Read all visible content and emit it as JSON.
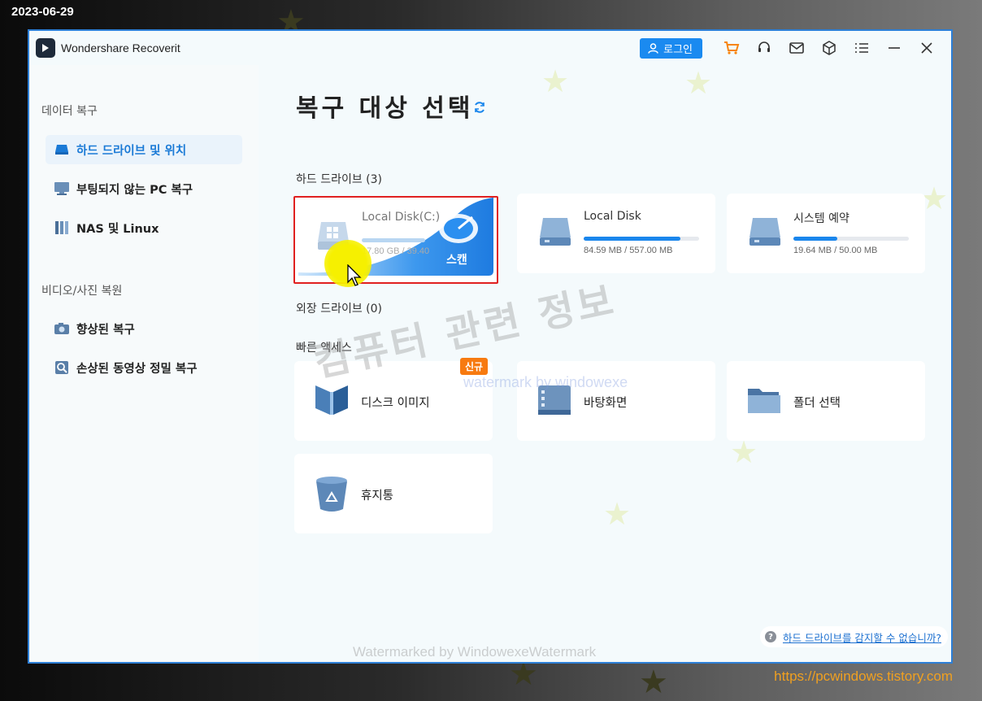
{
  "stamp": {
    "date": "2023-06-29",
    "url": "https://pcwindows.tistory.com"
  },
  "app": {
    "title": "Wondershare Recoverit",
    "login_label": "로그인",
    "toolbar_icons": [
      "cart-icon",
      "headset-icon",
      "mail-icon",
      "cube-icon",
      "menu-icon",
      "minimize-icon",
      "close-icon"
    ]
  },
  "sidebar": {
    "data_heading": "데이터 복구",
    "media_heading": "비디오/사진 복원",
    "items": [
      {
        "label": "하드 드라이브 및 위치",
        "icon": "hard-drive-icon",
        "active": true
      },
      {
        "label": "부팅되지 않는 PC 복구",
        "icon": "monitor-icon",
        "active": false
      },
      {
        "label": "NAS 및 Linux",
        "icon": "nas-icon",
        "active": false
      },
      {
        "label": "향상된 복구",
        "icon": "camera-icon",
        "active": false
      },
      {
        "label": "손상된 동영상 정밀 복구",
        "icon": "video-repair-icon",
        "active": false
      }
    ]
  },
  "main": {
    "title": "복구 대상 선택",
    "hard_drives_label": "하드 드라이브 (3)",
    "external_label": "외장 드라이브 (0)",
    "quick_access_label": "빠른 액세스",
    "drives": [
      {
        "name": "Local Disk(C:)",
        "size": "17.80 GB / 39.40",
        "usage": 0.45,
        "scan_label": "스캔"
      },
      {
        "name": "Local Disk",
        "size": "84.59 MB / 557.00 MB",
        "usage": 0.84
      },
      {
        "name": "시스템 예약",
        "size": "19.64 MB / 50.00 MB",
        "usage": 0.38
      }
    ],
    "quick_access": [
      {
        "label": "디스크 이미지",
        "badge": "신규",
        "icon": "disk-image-icon"
      },
      {
        "label": "바탕화면",
        "icon": "desktop-icon"
      },
      {
        "label": "폴더 선택",
        "icon": "folder-icon"
      },
      {
        "label": "휴지통",
        "icon": "recycle-bin-icon"
      }
    ],
    "help_link": "하드 드라이브를 감지할 수 없습니까?"
  },
  "watermarks": {
    "big": "컴퓨터 관련 정보",
    "small": "watermark by windowexe",
    "bottom": "Watermarked by WindowexeWatermark"
  },
  "colors": {
    "accent": "#1a86ec",
    "highlight_border": "#e02020",
    "badge": "#f77a10",
    "url": "#f0a020"
  }
}
